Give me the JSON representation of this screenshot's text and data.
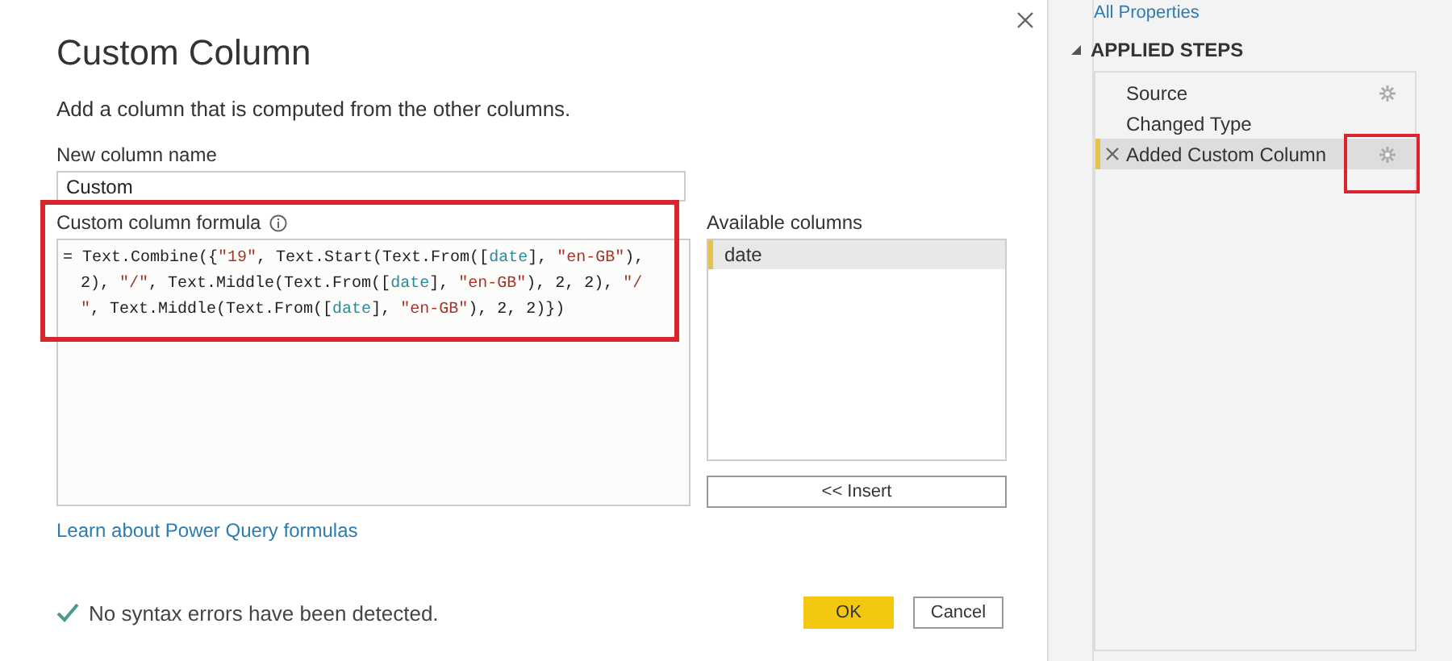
{
  "dialog": {
    "title": "Custom Column",
    "subtitle": "Add a column that is computed from the other columns.",
    "name_label": "New column name",
    "name_value": "Custom",
    "formula_label": "Custom column formula",
    "formula_highlighted": true,
    "formula_lines": [
      [
        {
          "kind": "code",
          "text": "= Text.Combine({"
        },
        {
          "kind": "string",
          "text": "\"19\""
        },
        {
          "kind": "code",
          "text": ", Text.Start(Text.From(["
        },
        {
          "kind": "field",
          "text": "date"
        },
        {
          "kind": "code",
          "text": "], "
        },
        {
          "kind": "string",
          "text": "\"en-GB\""
        },
        {
          "kind": "code",
          "text": "),"
        }
      ],
      [
        {
          "kind": "code",
          "text": "2), "
        },
        {
          "kind": "string",
          "text": "\"/\""
        },
        {
          "kind": "code",
          "text": ", Text.Middle(Text.From(["
        },
        {
          "kind": "field",
          "text": "date"
        },
        {
          "kind": "code",
          "text": "], "
        },
        {
          "kind": "string",
          "text": "\"en-GB\""
        },
        {
          "kind": "code",
          "text": "), 2, 2), "
        },
        {
          "kind": "string",
          "text": "\"/"
        }
      ],
      [
        {
          "kind": "string",
          "text": "\""
        },
        {
          "kind": "code",
          "text": ", Text.Middle(Text.From(["
        },
        {
          "kind": "field",
          "text": "date"
        },
        {
          "kind": "code",
          "text": "], "
        },
        {
          "kind": "string",
          "text": "\"en-GB\""
        },
        {
          "kind": "code",
          "text": "), 2, 2)})"
        }
      ]
    ],
    "available_label": "Available columns",
    "available_columns": [
      {
        "label": "date",
        "selected": true
      }
    ],
    "insert_button": "<< Insert",
    "learn_link": "Learn about Power Query formulas",
    "status": "No syntax errors have been detected.",
    "ok_button": "OK",
    "cancel_button": "Cancel"
  },
  "side_panel": {
    "properties_link": "All Properties",
    "steps_title": "APPLIED STEPS",
    "steps": [
      {
        "label": "Source",
        "selected": false,
        "has_gear": true,
        "deletable": false,
        "highlighted": false
      },
      {
        "label": "Changed Type",
        "selected": false,
        "has_gear": false,
        "deletable": false,
        "highlighted": false
      },
      {
        "label": "Added Custom Column",
        "selected": true,
        "has_gear": true,
        "deletable": true,
        "highlighted": true
      }
    ]
  }
}
